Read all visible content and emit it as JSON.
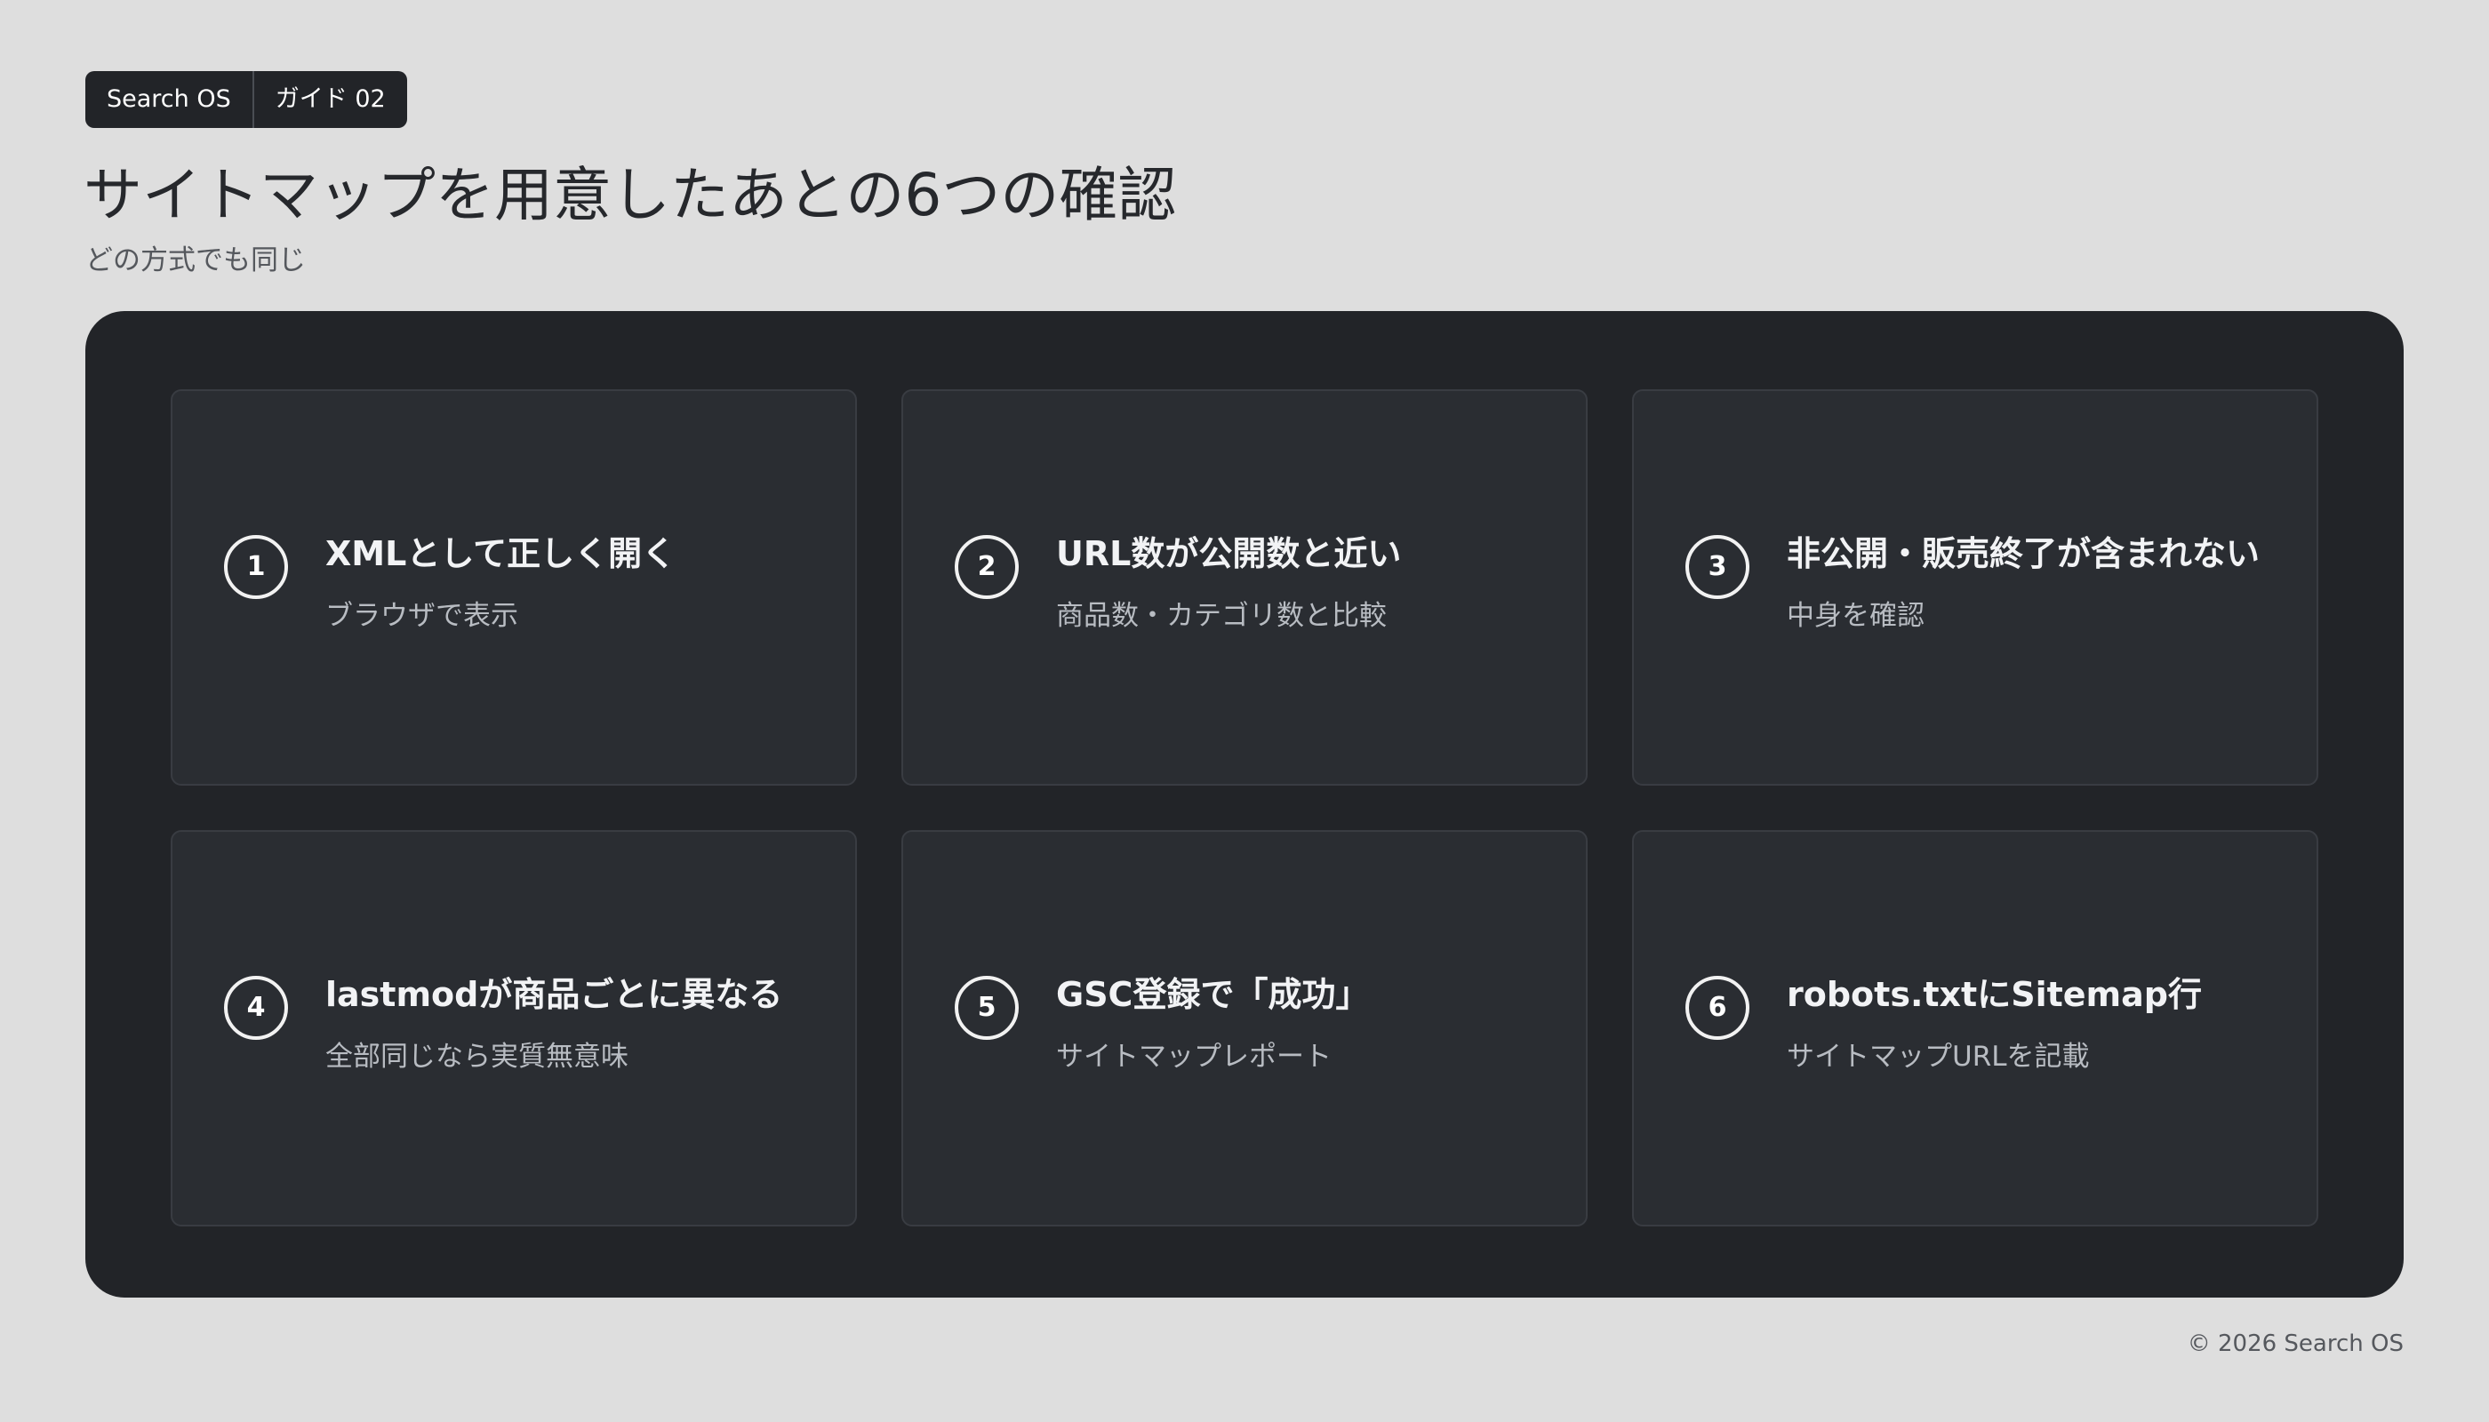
{
  "badge": {
    "brand": "Search OS",
    "guide": "ガイド 02"
  },
  "header": {
    "title": "サイトマップを用意したあとの6つの確認",
    "subtitle": "どの方式でも同じ"
  },
  "cards": [
    {
      "number": "1",
      "title": "XMLとして正しく開く",
      "subtitle": "ブラウザで表示"
    },
    {
      "number": "2",
      "title": "URL数が公開数と近い",
      "subtitle": "商品数・カテゴリ数と比較"
    },
    {
      "number": "3",
      "title": "非公開・販売終了が含まれない",
      "subtitle": "中身を確認"
    },
    {
      "number": "4",
      "title": "lastmodが商品ごとに異なる",
      "subtitle": "全部同じなら実質無意味"
    },
    {
      "number": "5",
      "title": "GSC登録で「成功」",
      "subtitle": "サイトマップレポート"
    },
    {
      "number": "6",
      "title": "robots.txtにSitemap行",
      "subtitle": "サイトマップURLを記載"
    }
  ],
  "footer": {
    "copyright": "© 2026 Search OS"
  }
}
